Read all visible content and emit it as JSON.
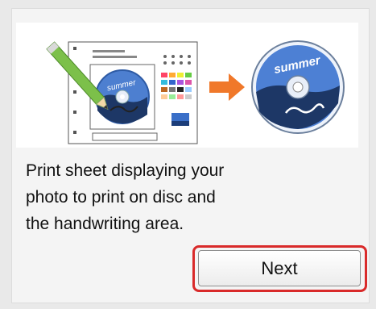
{
  "dialog": {
    "description_lines": [
      "Print sheet displaying your",
      "photo to print on disc and",
      "the handwriting area."
    ],
    "next_label": "Next"
  },
  "illustration": {
    "disc_label": "summer",
    "icons": [
      "handwriting-sheet-icon",
      "pencil-icon",
      "right-arrow-icon",
      "printed-disc-icon"
    ]
  },
  "colors": {
    "highlight": "#d92a2a",
    "arrow": "#f0782a",
    "pencil": "#7cc04a",
    "disc_blue": "#3d6fc4"
  }
}
